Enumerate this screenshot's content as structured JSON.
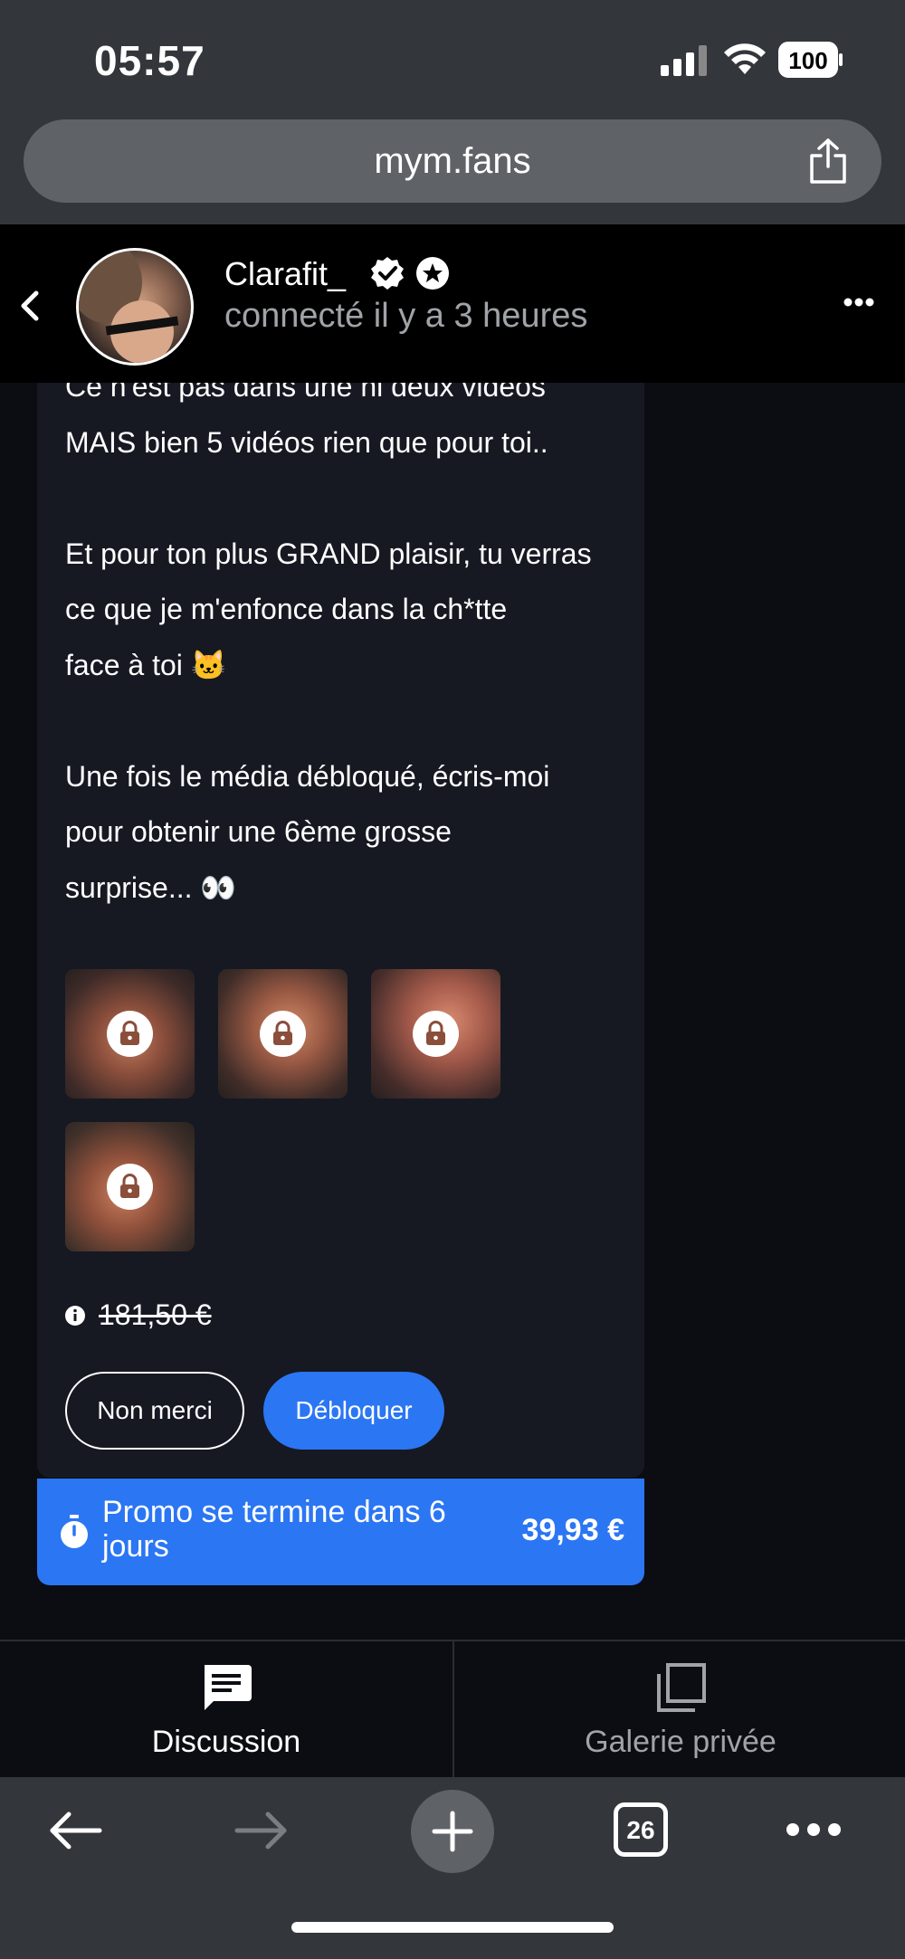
{
  "status_bar": {
    "time": "05:57",
    "battery": "100",
    "signal_icon": "signal-icon",
    "wifi_icon": "wifi-icon",
    "battery_icon": "battery-icon"
  },
  "browser": {
    "url": "mym.fans",
    "share_icon": "share-icon"
  },
  "chat_header": {
    "name": "Clarafit_",
    "status": "connecté il y a 3 heures",
    "icons": [
      "back-chevron-icon",
      "verified-badge-icon",
      "star-badge-icon",
      "more-options-icon"
    ]
  },
  "message": {
    "text": "Ce n'est pas dans une ni deux vidéos\nMAIS bien 5 vidéos rien que pour toi..\n\nEt pour ton plus GRAND plaisir, tu verras\nce que je m'enfonce dans la ch*tte\nface à toi 🐱\n\nUne fois le média débloqué, écris-moi\npour obtenir une 6ème grosse\nsurprise... 👀",
    "locked_media_count": 4,
    "original_price": "181,50 €",
    "buttons": {
      "decline": "Non merci",
      "unlock": "Débloquer"
    }
  },
  "promo": {
    "text": "Promo se termine dans 6 jours",
    "price": "39,93 €",
    "icon": "stopwatch-icon"
  },
  "bottom_tabs": [
    {
      "label": "Discussion",
      "icon": "chat-icon",
      "active": true
    },
    {
      "label": "Galerie privée",
      "icon": "gallery-icon",
      "active": false
    }
  ],
  "browser_toolbar": {
    "tab_count": "26",
    "icons": [
      "back-arrow-icon",
      "forward-arrow-icon",
      "new-tab-icon",
      "tabs-icon",
      "more-icon"
    ]
  },
  "colors": {
    "accent": "#2b76f3",
    "background": "#0b0d12",
    "bubble": "#161922",
    "chrome": "#33363b"
  }
}
